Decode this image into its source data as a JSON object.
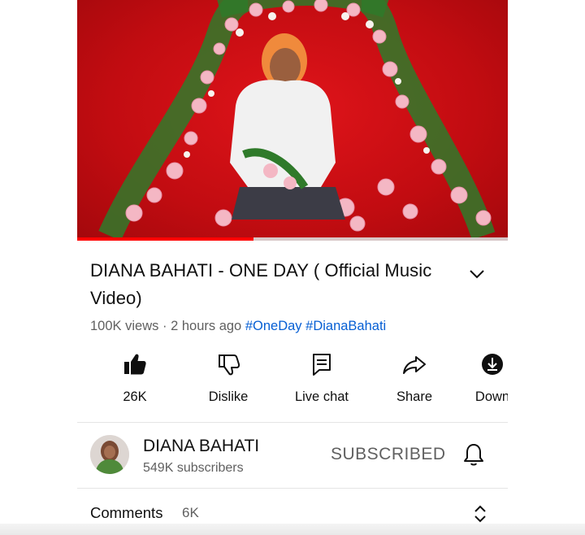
{
  "video": {
    "progress_fraction": 0.41,
    "colors": {
      "background": "#d10f14",
      "progress": "#ff0000"
    }
  },
  "title": "DIANA BAHATI - ONE DAY ( Official Music Video)",
  "meta": {
    "views": "100K views",
    "separator": "·",
    "time": "2 hours ago",
    "tags": [
      "#OneDay",
      "#DianaBahati"
    ]
  },
  "actions": {
    "like": {
      "label": "26K",
      "icon": "thumbs-up-filled-icon"
    },
    "dislike": {
      "label": "Dislike",
      "icon": "thumbs-down-icon"
    },
    "live_chat": {
      "label": "Live chat",
      "icon": "chat-icon"
    },
    "share": {
      "label": "Share",
      "icon": "share-icon"
    },
    "download": {
      "label": "Down",
      "icon": "download-icon"
    }
  },
  "channel": {
    "name": "DIANA BAHATI",
    "subscribers": "549K subscribers",
    "subscribe_state": "SUBSCRIBED"
  },
  "comments": {
    "label": "Comments",
    "count": "6K"
  },
  "colors": {
    "accent_link": "#065fd4",
    "text_primary": "#0f0f0f",
    "text_secondary": "#606060"
  }
}
